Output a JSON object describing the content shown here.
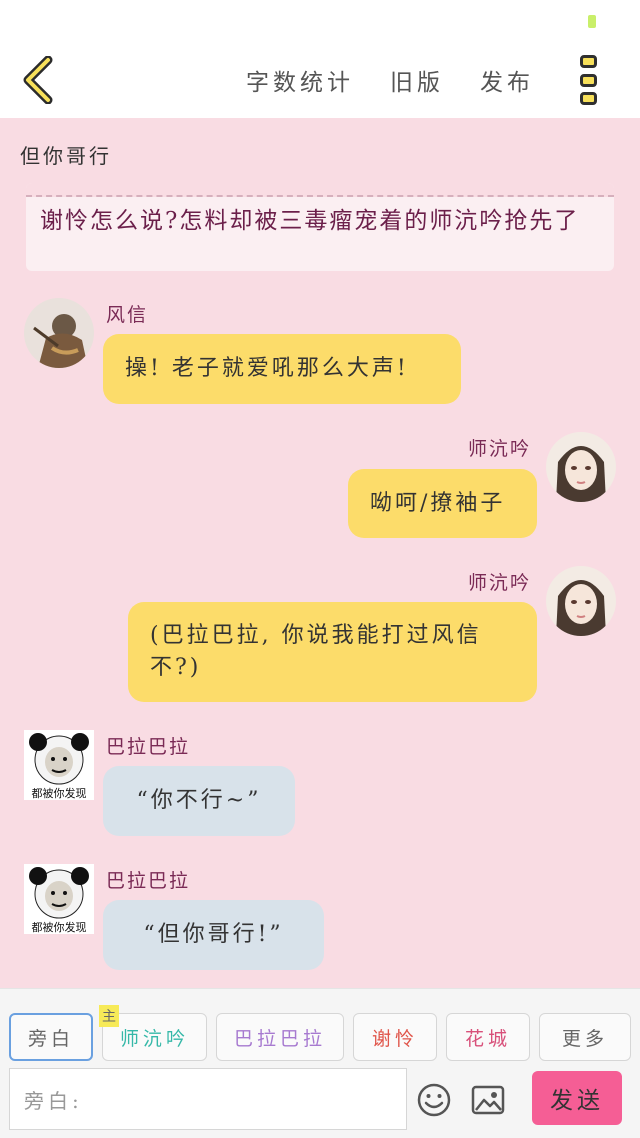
{
  "toolbar": {
    "word_count": "字数统计",
    "old_version": "旧版",
    "publish": "发布"
  },
  "document": {
    "title": "但你哥行",
    "narration_text": "谢怜怎么说?怎料却被三毒瘤宠着的师沆吟抢先了"
  },
  "messages": [
    {
      "speaker": "风信",
      "text": "操! 老子就爱吼那么大声!",
      "side": "left",
      "bubble_color": "#fcdc6a"
    },
    {
      "speaker": "师沆吟",
      "text": "呦呵/撩袖子",
      "side": "right",
      "bubble_color": "#fcdc6a"
    },
    {
      "speaker": "师沆吟",
      "text_line1": "(巴拉巴拉, 你说我能打过风信",
      "text_line2": "不?)",
      "side": "right",
      "bubble_color": "#fcdc6a"
    },
    {
      "speaker": "巴拉巴拉",
      "text": "“你不行~”",
      "side": "left",
      "bubble_color": "#d8e2ea",
      "avatar_caption": "都被你发现"
    },
    {
      "speaker": "巴拉巴拉",
      "text": "“但你哥行!”",
      "side": "left",
      "bubble_color": "#d8e2ea",
      "avatar_caption": "都被你发现"
    }
  ],
  "roles": {
    "main_tag": "主",
    "items": [
      "旁白",
      "师沆吟",
      "巴拉巴拉",
      "谢怜",
      "花城",
      "更多"
    ],
    "colors": [
      "#666666",
      "#35b8a8",
      "#a77ad0",
      "#e0554a",
      "#d8507a",
      "#666666"
    ],
    "selected": "旁白"
  },
  "composer": {
    "placeholder": "旁白:",
    "emoji_icon": "smiley-icon",
    "image_icon": "image-icon",
    "send_label": "发送"
  },
  "colors": {
    "background": "#f9dce3",
    "bubble_yellow": "#fcdc6a",
    "bubble_grey": "#d8e2ea",
    "speaker_name": "#7a2a55",
    "send_button": "#f55e95",
    "menu_dot": "#f7e05a"
  }
}
